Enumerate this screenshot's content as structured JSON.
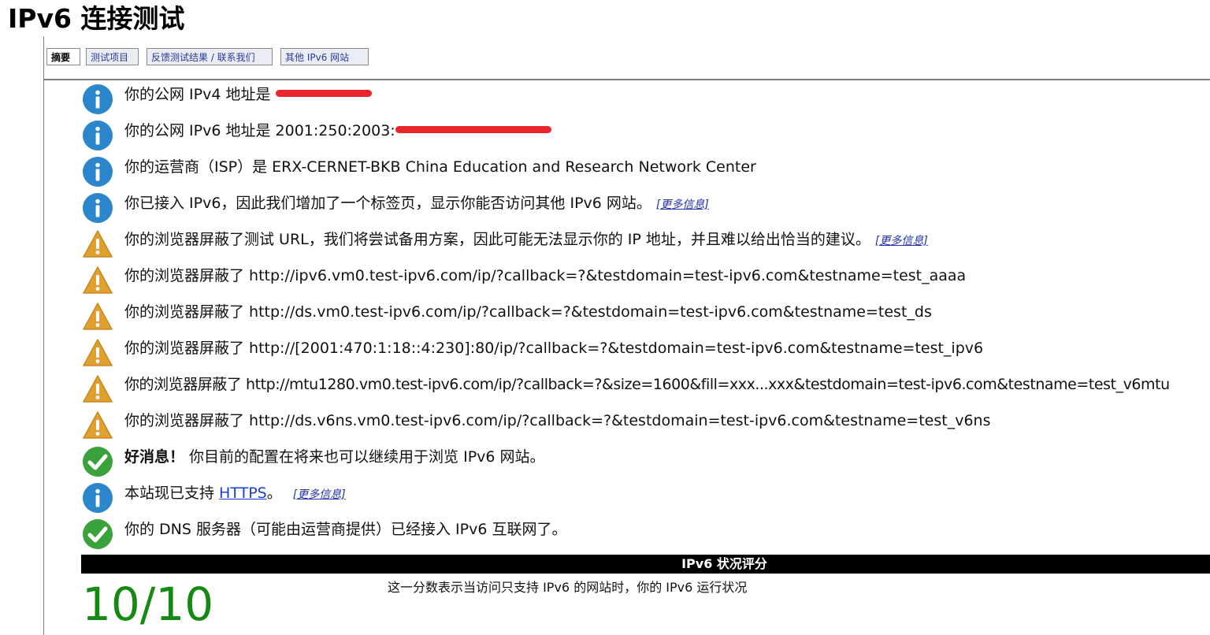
{
  "title": "IPv6 连接测试",
  "tabs": [
    {
      "label": "摘要",
      "active": true
    },
    {
      "label": "测试项目",
      "active": false
    },
    {
      "label": "反馈测试结果 / 联系我们",
      "active": false
    },
    {
      "label": "其他 IPv6 网站",
      "active": false
    }
  ],
  "more_info_label": "[更多信息]",
  "messages": [
    {
      "icon": "info-icon",
      "text": "你的公网 IPv4 地址是 "
    },
    {
      "icon": "info-icon",
      "text": "你的公网 IPv6 地址是 2001:250:2003:"
    },
    {
      "icon": "info-icon",
      "text": "你的运营商（ISP）是 ERX-CERNET-BKB China Education and Research Network Center"
    },
    {
      "icon": "info-icon",
      "text": "你已接入 IPv6，因此我们增加了一个标签页，显示你能否访问其他 IPv6 网站。"
    },
    {
      "icon": "warning-icon",
      "text": "你的浏览器屏蔽了测试 URL，我们将尝试备用方案，因此可能无法显示你的 IP 地址，并且难以给出恰当的建议。"
    },
    {
      "icon": "warning-icon",
      "text": "你的浏览器屏蔽了 http://ipv6.vm0.test-ipv6.com/ip/?callback=?&testdomain=test-ipv6.com&testname=test_aaaa"
    },
    {
      "icon": "warning-icon",
      "text": "你的浏览器屏蔽了 http://ds.vm0.test-ipv6.com/ip/?callback=?&testdomain=test-ipv6.com&testname=test_ds"
    },
    {
      "icon": "warning-icon",
      "text": "你的浏览器屏蔽了 http://[2001:470:1:18::4:230]:80/ip/?callback=?&testdomain=test-ipv6.com&testname=test_ipv6"
    },
    {
      "icon": "warning-icon",
      "text": "你的浏览器屏蔽了 http://mtu1280.vm0.test-ipv6.com/ip/?callback=?&size=1600&fill=xxx...xxx&testdomain=test-ipv6.com&testname=test_v6mtu"
    },
    {
      "icon": "warning-icon",
      "text": "你的浏览器屏蔽了 http://ds.v6ns.vm0.test-ipv6.com/ip/?callback=?&testdomain=test-ipv6.com&testname=test_v6ns"
    },
    {
      "icon": "check-icon",
      "bold": "好消息！",
      "text": " 你目前的配置在将来也可以继续用于浏览 IPv6 网站。"
    },
    {
      "icon": "info-icon",
      "text": "本站现已支持 ",
      "link": "HTTPS",
      "after": "。"
    },
    {
      "icon": "check-icon",
      "text": "你的 DNS 服务器（可能由运营商提供）已经接入 IPv6 互联网了。"
    }
  ],
  "score": {
    "header": "IPv6 状况评分",
    "value": "10/10",
    "description": "这一分数表示当访问只支持 IPv6 的网站时，你的 IPv6 运行状况"
  },
  "colors": {
    "info_blue": "#2b86cc",
    "warning_amber": "#e0a030",
    "check_green": "#3aa23a",
    "score_green": "#148a14",
    "redaction": "#e8262c"
  }
}
